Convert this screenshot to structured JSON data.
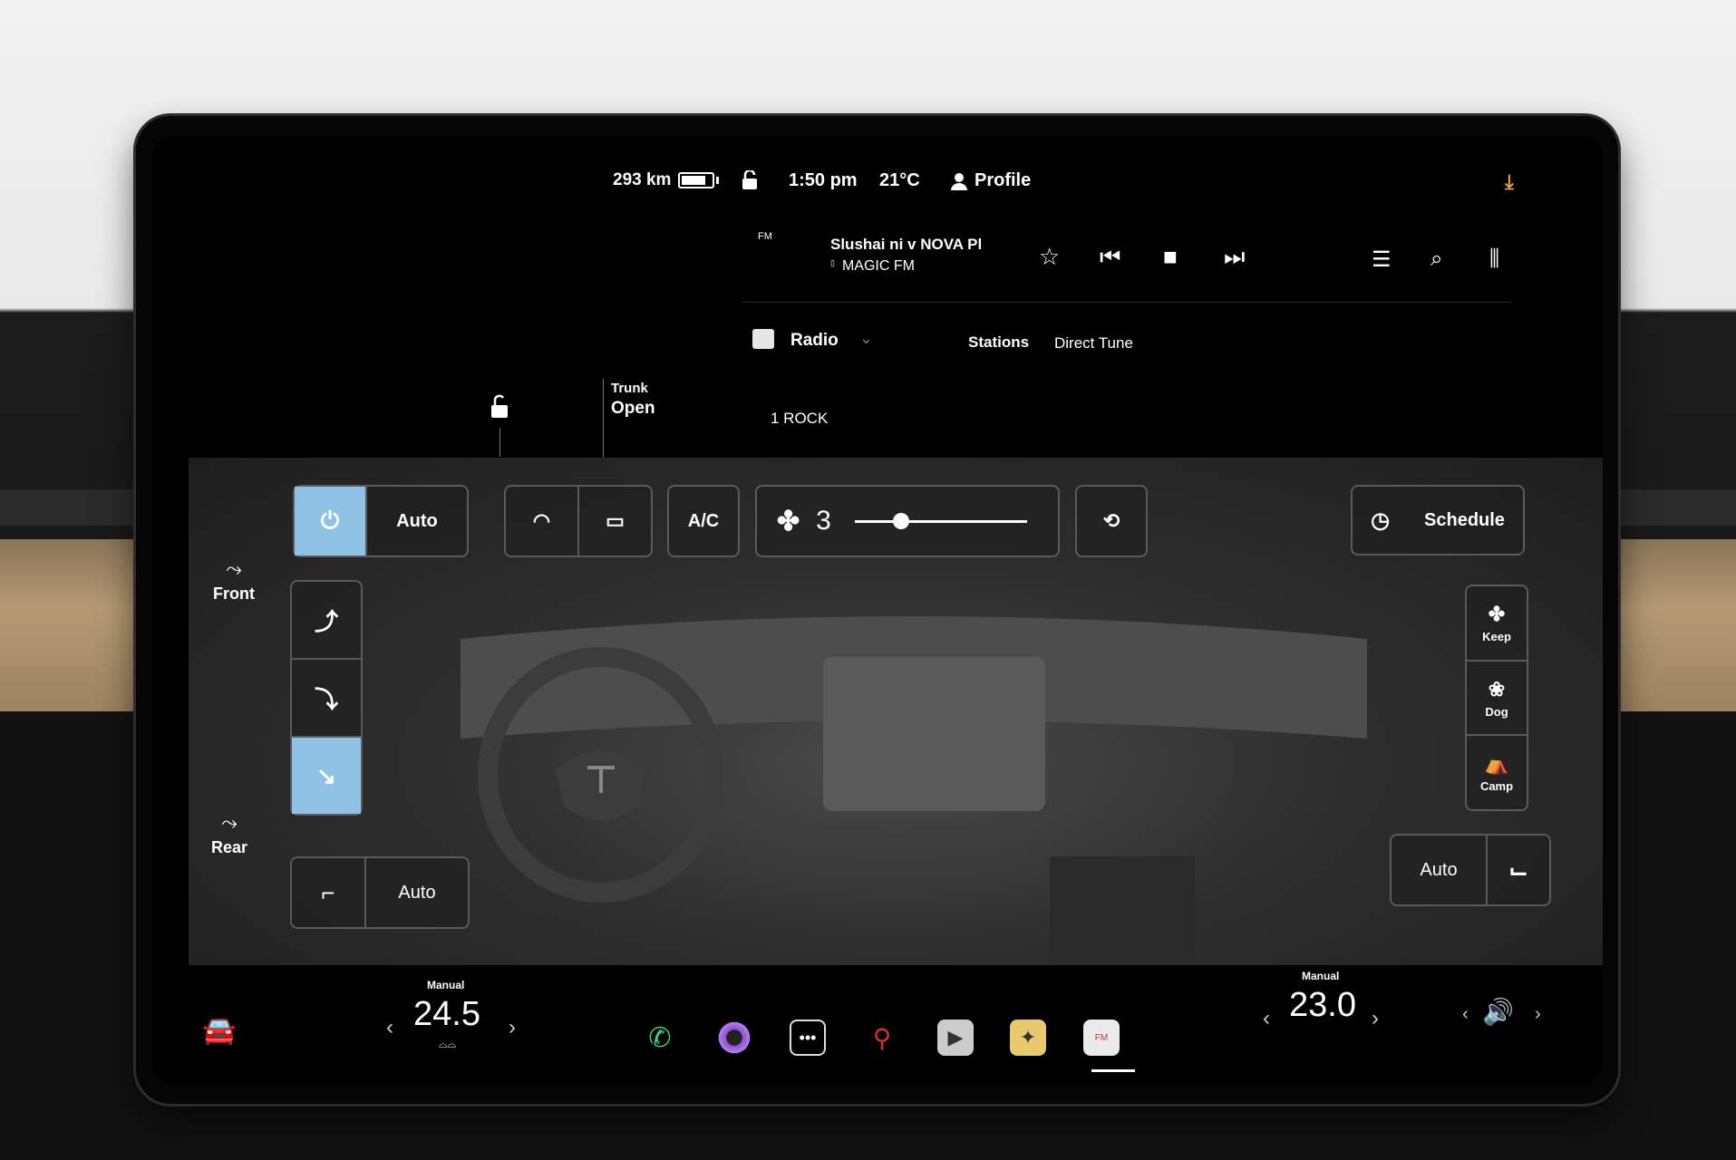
{
  "status": {
    "range": "293 km",
    "time": "1:50 pm",
    "outside_temp": "21°C",
    "profile": "Profile"
  },
  "media": {
    "band": "FM",
    "track": "Slushai ni v NOVA Pl",
    "station": "MAGIC FM",
    "source": "Radio",
    "tabs": [
      "Stations",
      "Direct Tune"
    ],
    "list_item": "1 ROCK"
  },
  "car": {
    "trunk_label": "Trunk",
    "trunk_state": "Open"
  },
  "climate": {
    "auto_label": "Auto",
    "ac_label": "A/C",
    "fan_speed": "3",
    "fan_level_fraction": 0.27,
    "schedule_label": "Schedule",
    "front_label": "Front",
    "rear_label": "Rear",
    "seat_auto_left": "Auto",
    "seat_auto_right": "Auto",
    "modes": [
      "Keep",
      "Dog",
      "Camp"
    ],
    "accent_color": "#8fc3e6"
  },
  "bottom_bar": {
    "driver_mode": "Manual",
    "driver_temp": "24.5",
    "passenger_mode": "Manual",
    "passenger_temp": "23.0",
    "apps": [
      "phone-icon",
      "camera-icon",
      "more-icon",
      "joystick-icon",
      "theater-icon",
      "toybox-icon",
      "radio-icon"
    ]
  }
}
